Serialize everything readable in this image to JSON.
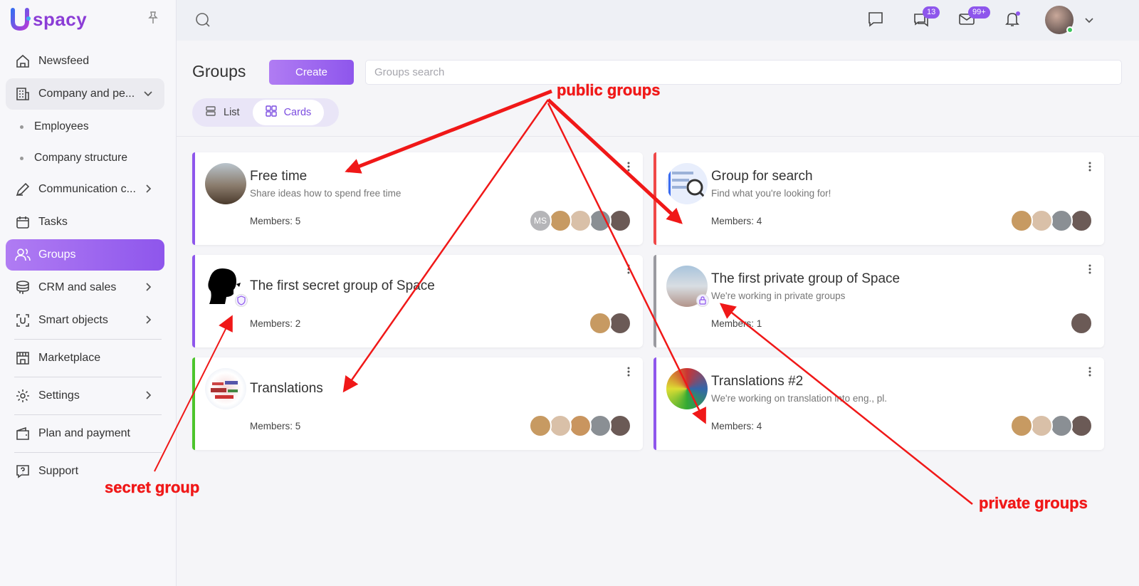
{
  "app": {
    "logo_text": "spacy"
  },
  "sidebar": {
    "items": [
      {
        "label": "Newsfeed",
        "icon": "home-icon"
      },
      {
        "label": "Company and pe...",
        "icon": "building-icon"
      },
      {
        "label": "Employees"
      },
      {
        "label": "Company structure"
      },
      {
        "label": "Communication c...",
        "icon": "communication-icon"
      },
      {
        "label": "Tasks",
        "icon": "calendar-icon"
      },
      {
        "label": "Groups",
        "icon": "users-icon"
      },
      {
        "label": "CRM and sales",
        "icon": "coins-icon"
      },
      {
        "label": "Smart objects",
        "icon": "smart-object-icon"
      },
      {
        "label": "Marketplace",
        "icon": "store-icon"
      },
      {
        "label": "Settings",
        "icon": "gear-icon"
      },
      {
        "label": "Plan and payment",
        "icon": "wallet-icon"
      },
      {
        "label": "Support",
        "icon": "help-icon"
      }
    ]
  },
  "header": {
    "chat_badge": "13",
    "mail_badge": "99+"
  },
  "main": {
    "title": "Groups",
    "create_label": "Create",
    "search_placeholder": "Groups search",
    "view_list_label": "List",
    "view_cards_label": "Cards"
  },
  "groups": [
    {
      "name": "Free time",
      "description": "Share ideas how to spend free time",
      "members": "Members: 5",
      "accent": "#8e56ec"
    },
    {
      "name": "Group for search",
      "description": "Find what you're looking for!",
      "members": "Members: 4",
      "accent": "#f04848"
    },
    {
      "name": "The first secret group of Space",
      "description": "",
      "members": "Members: 2",
      "accent": "#8e56ec"
    },
    {
      "name": "The first private group of Space",
      "description": "We're working in private groups",
      "members": "Members: 1",
      "accent": "#9a9aa0"
    },
    {
      "name": "Translations",
      "description": "",
      "members": "Members: 5",
      "accent": "#4cc42c"
    },
    {
      "name": "Translations #2",
      "description": "We're working on translation into eng., pl.",
      "members": "Members: 4",
      "accent": "#8e56ec"
    }
  ],
  "member_initials": "MS",
  "annotations": {
    "public": "public groups",
    "secret": "secret group",
    "private": "private groups"
  }
}
